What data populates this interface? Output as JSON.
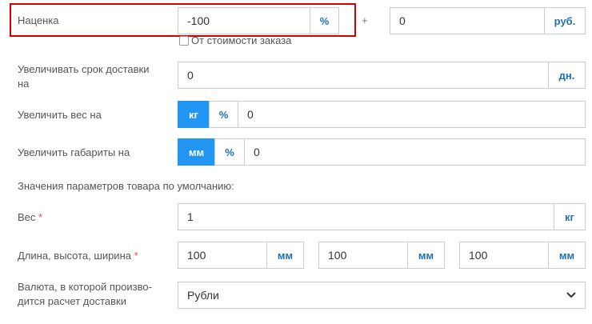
{
  "markup": {
    "label": "Наценка",
    "percent_value": "-100",
    "percent_unit": "%",
    "plus": "+",
    "rub_value": "0",
    "rub_unit": "руб.",
    "from_order_cost_label": "От стоимости заказа"
  },
  "delivery_time": {
    "label_line1": "Увеличивать срок доставки",
    "label_line2": "на",
    "value": "0",
    "unit": "дн."
  },
  "weight_increase": {
    "label": "Увеличить вес на",
    "unit_kg": "кг",
    "unit_percent": "%",
    "value": "0"
  },
  "dimensions_increase": {
    "label": "Увеличить габариты на",
    "unit_mm": "мм",
    "unit_percent": "%",
    "value": "0"
  },
  "defaults_heading": "Значения параметров товара по умолчанию:",
  "default_weight": {
    "label": "Вес",
    "required_mark": "*",
    "value": "1",
    "unit": "кг"
  },
  "default_dimensions": {
    "label": "Длина, высота, ширина",
    "required_mark": "*",
    "length": "100",
    "height": "100",
    "width": "100",
    "unit": "мм"
  },
  "currency": {
    "label_line1": "Валюта, в которой произво-",
    "label_line2": "дится расчет доставки",
    "selected": "Рубли"
  },
  "colors": {
    "accent": "#2196f3",
    "unit_text": "#1e6fb8",
    "highlight_box": "#d00000",
    "required": "#d9534f"
  },
  "icons": {
    "select_arrow": "chevron-down-icon"
  }
}
